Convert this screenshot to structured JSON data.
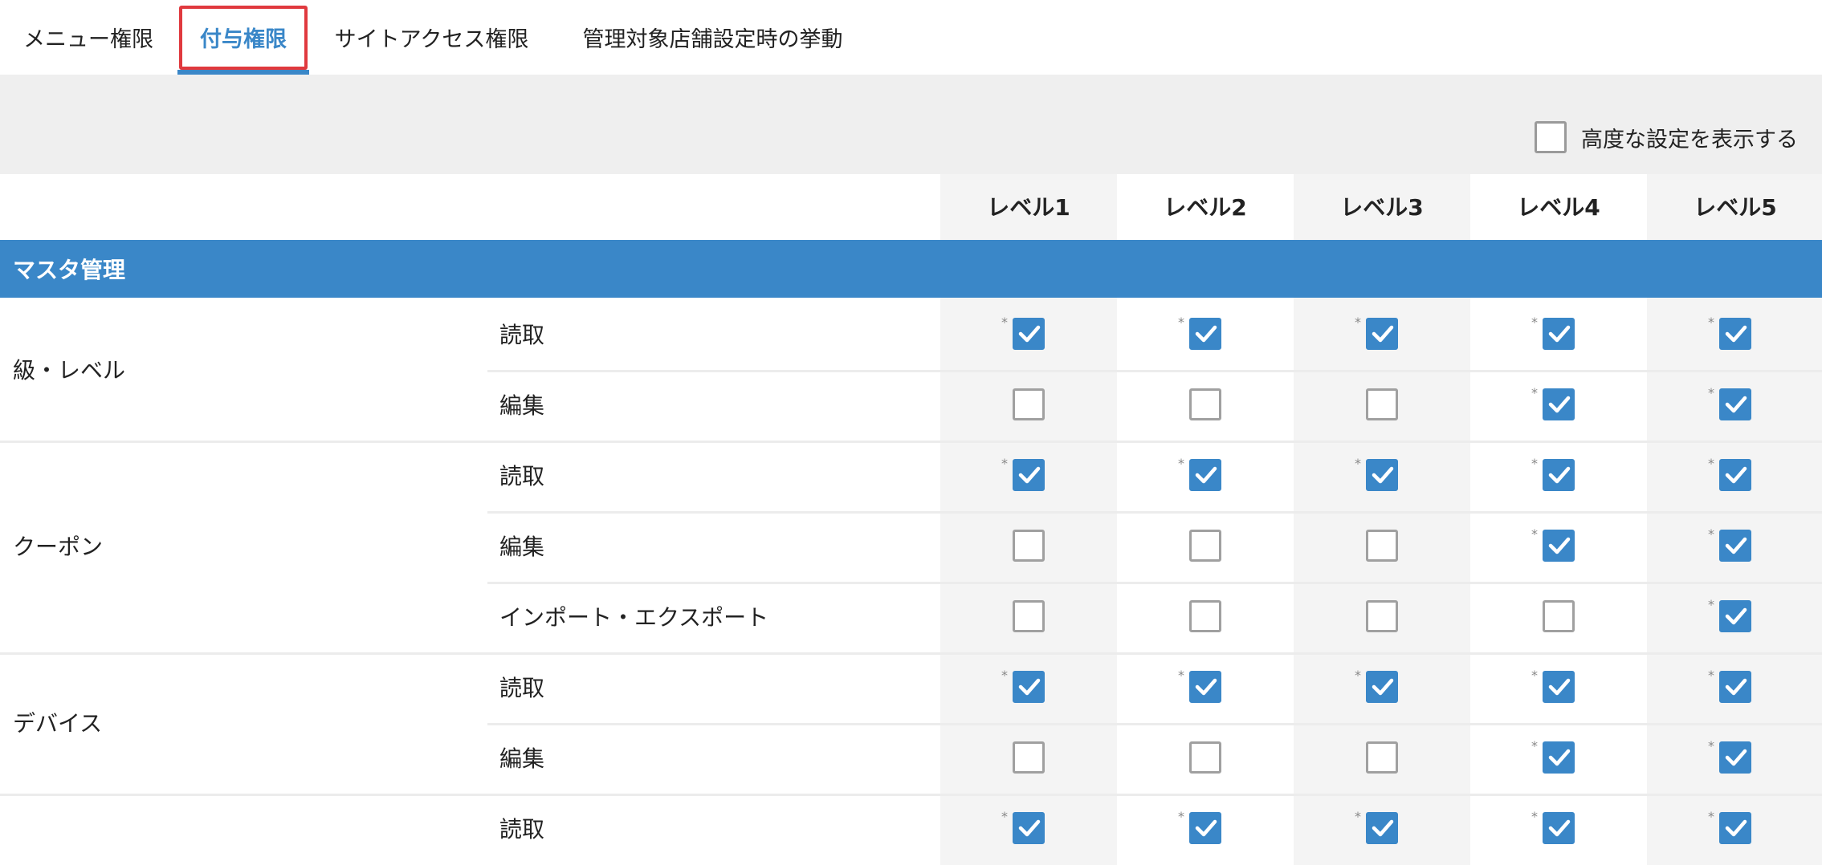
{
  "tabs": [
    {
      "label": "メニュー権限",
      "active": false
    },
    {
      "label": "付与権限",
      "active": true
    },
    {
      "label": "サイトアクセス権限",
      "active": false
    },
    {
      "label": "管理対象店舗設定時の挙動",
      "active": false
    }
  ],
  "advanced": {
    "label": "高度な設定を表示する",
    "checked": false
  },
  "levels": [
    "レベル1",
    "レベル2",
    "レベル3",
    "レベル4",
    "レベル5"
  ],
  "section": {
    "title": "マスタ管理"
  },
  "star_glyph": "*",
  "groups": [
    {
      "label": "級・レベル",
      "rows": [
        {
          "label": "読取",
          "checks": [
            true,
            true,
            true,
            true,
            true
          ]
        },
        {
          "label": "編集",
          "checks": [
            false,
            false,
            false,
            true,
            true
          ]
        }
      ]
    },
    {
      "label": "クーポン",
      "rows": [
        {
          "label": "読取",
          "checks": [
            true,
            true,
            true,
            true,
            true
          ]
        },
        {
          "label": "編集",
          "checks": [
            false,
            false,
            false,
            true,
            true
          ]
        },
        {
          "label": "インポート・エクスポート",
          "checks": [
            false,
            false,
            false,
            false,
            true
          ]
        }
      ]
    },
    {
      "label": "デバイス",
      "rows": [
        {
          "label": "読取",
          "checks": [
            true,
            true,
            true,
            true,
            true
          ]
        },
        {
          "label": "編集",
          "checks": [
            false,
            false,
            false,
            true,
            true
          ]
        }
      ]
    },
    {
      "label": "",
      "rows": [
        {
          "label": "読取",
          "checks": [
            true,
            true,
            true,
            true,
            true
          ]
        }
      ]
    }
  ]
}
